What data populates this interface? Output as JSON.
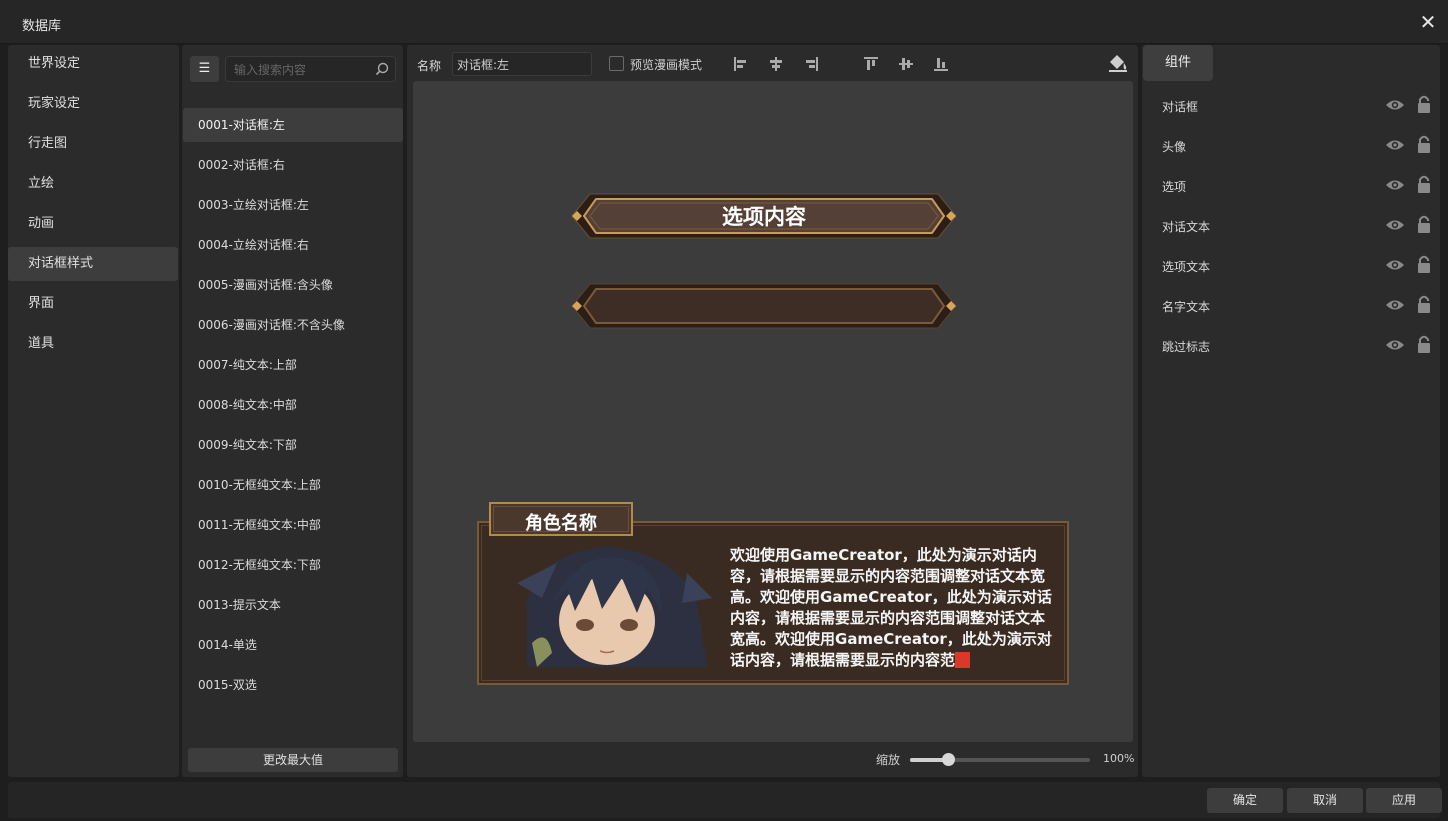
{
  "window": {
    "title": "数据库"
  },
  "categories": [
    {
      "label": "世界设定",
      "active": false
    },
    {
      "label": "玩家设定",
      "active": false
    },
    {
      "label": "行走图",
      "active": false
    },
    {
      "label": "立绘",
      "active": false
    },
    {
      "label": "动画",
      "active": false
    },
    {
      "label": "对话框样式",
      "active": true
    },
    {
      "label": "界面",
      "active": false
    },
    {
      "label": "道具",
      "active": false
    }
  ],
  "list": {
    "search_placeholder": "输入搜索内容",
    "items": [
      "0001-对话框:左",
      "0002-对话框:右",
      "0003-立绘对话框:左",
      "0004-立绘对话框:右",
      "0005-漫画对话框:含头像",
      "0006-漫画对话框:不含头像",
      "0007-纯文本:上部",
      "0008-纯文本:中部",
      "0009-纯文本:下部",
      "0010-无框纯文本:上部",
      "0011-无框纯文本:中部",
      "0012-无框纯文本:下部",
      "0013-提示文本",
      "0014-单选",
      "0015-双选"
    ],
    "selected_index": 0,
    "max_button": "更改最大值"
  },
  "editor": {
    "name_label": "名称",
    "name_value": "对话框:左",
    "preview_comic_label": "预览漫画模式",
    "preview_comic_checked": false,
    "zoom_label": "缩放",
    "zoom_value": "100%",
    "zoom_fraction": 0.21
  },
  "preview": {
    "option_text": "选项内容",
    "speaker_name": "角色名称",
    "dialog_text": "欢迎使用GameCreator，此处为演示对话内容，请根据需要显示的内容范围调整对话文本宽高。欢迎使用GameCreator，此处为演示对话内容，请根据需要显示的内容范围调整对话文本宽高。欢迎使用GameCreator，此处为演示对话内容，请根据需要显示的内容范"
  },
  "components": {
    "tab_label": "组件",
    "items": [
      "对话框",
      "头像",
      "选项",
      "对话文本",
      "选项文本",
      "名字文本",
      "跳过标志"
    ]
  },
  "footer": {
    "ok": "确定",
    "cancel": "取消",
    "apply": "应用"
  },
  "colors": {
    "accent_gold": "#b48a4a",
    "plate_fill": "#4a382d",
    "dialog_fill": "#3a2b22",
    "cursor_red": "#d9382b"
  }
}
